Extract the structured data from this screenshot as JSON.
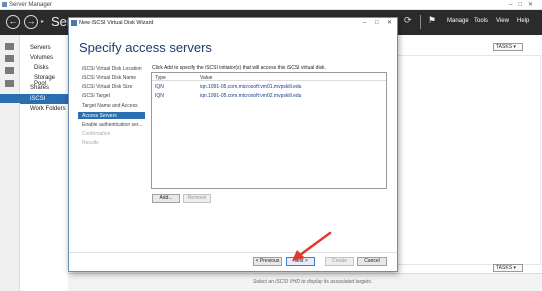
{
  "window": {
    "title": "Server Manager",
    "controls": [
      "–",
      "□",
      "✕"
    ]
  },
  "header": {
    "breadcrumb": "Serv",
    "menu": [
      "Manage",
      "Tools",
      "View",
      "Help"
    ]
  },
  "nav": {
    "items": [
      "Servers",
      "Volumes",
      "Disks",
      "Storage Pool",
      "Shares",
      "iSCSI",
      "Work Folders"
    ],
    "selected": "iSCSI"
  },
  "tasks_label": "TASKS",
  "bottom_hint": "Select an iSCSI VHD to display its associated targets.",
  "wizard": {
    "title": "New iSCSI Virtual Disk Wizard",
    "heading": "Specify access servers",
    "steps": [
      "iSCSI Virtual Disk Location",
      "iSCSI Virtual Disk Name",
      "iSCSI Virtual Disk Size",
      "iSCSI Target",
      "Target Name and Access",
      "Access Servers",
      "Enable authentication ser...",
      "Confirmation",
      "Results"
    ],
    "selected_step": "Access Servers",
    "description": "Click Add to specify the iSCSI initiator(s) that will access this iSCSI virtual disk.",
    "table": {
      "columns": [
        "Type",
        "Value"
      ],
      "rows": [
        {
          "type": "IQN",
          "value": "iqn.1991-05.com.microsoft:vm01.mvpskill.edu"
        },
        {
          "type": "IQN",
          "value": "iqn.1991-05.com.microsoft:vm02.mvpskill.edu"
        }
      ]
    },
    "add_button": "Add...",
    "remove_button": "Remove",
    "previous_button": "< Previous",
    "next_button": "Next >",
    "create_button": "Create",
    "cancel_button": "Cancel"
  },
  "colors": {
    "accent": "#2a6fb0",
    "header_bg": "#2b2b2b",
    "arrow": "#e03a2f"
  }
}
